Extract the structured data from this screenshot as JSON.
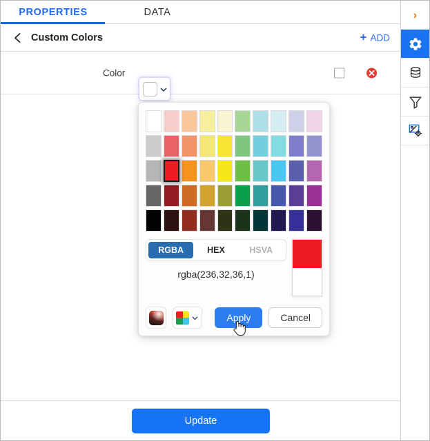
{
  "tabs": [
    {
      "label": "PROPERTIES",
      "active": true
    },
    {
      "label": "DATA",
      "active": false
    }
  ],
  "breadcrumb": {
    "back_icon": "chevron-left-icon",
    "title": "Custom Colors",
    "add_label": "ADD",
    "add_plus": "+"
  },
  "property_row": {
    "label": "Color",
    "swatch_value": "#ffffff",
    "caret_icon": "chevron-down-icon",
    "checkbox_checked": false,
    "delete_icon": "delete-circle-icon"
  },
  "picker": {
    "palette_rows": [
      [
        "#ffffff",
        "#f8cccb",
        "#fac79a",
        "#f6ef9c",
        "#f7f4cf",
        "#a6d796",
        "#aedfe8",
        "#d6ecf3",
        "#cfcfe8",
        "#f0d3e6"
      ],
      [
        "#cdcdcd",
        "#ec6264",
        "#f2936a",
        "#f5e872",
        "#f5e432",
        "#7fc77f",
        "#74cede",
        "#85dbe2",
        "#7e7dcb",
        "#9593cf"
      ],
      [
        "#b6b6b6",
        "#ed1c24",
        "#f5931e",
        "#fac96c",
        "#f6e718",
        "#6cbe45",
        "#68c8c9",
        "#4cc7f4",
        "#5a5fae",
        "#b267b0"
      ],
      [
        "#666666",
        "#931a20",
        "#ce6a22",
        "#d2a22f",
        "#9a9e33",
        "#08a04b",
        "#309e9d",
        "#4758ad",
        "#5b3d97",
        "#9a3296"
      ],
      [
        "#020202",
        "#2d110f",
        "#932d1f",
        "#653634",
        "#2d3314",
        "#1b3318",
        "#02373a",
        "#211a50",
        "#35309a",
        "#2b1031"
      ]
    ],
    "selected_row": 2,
    "selected_col": 1,
    "formats": [
      {
        "label": "RGBA",
        "state": "active"
      },
      {
        "label": "HEX",
        "state": "normal"
      },
      {
        "label": "HSVA",
        "state": "muted"
      }
    ],
    "value_text": "rgba(236,32,36,1)",
    "preview_new_color": "#ed1c24",
    "preview_old_color": "#ffffff",
    "gradient_icon": "gradient-picker-icon",
    "swatch_grid_icon": "palette-grid-icon",
    "swatch_grid_caret": "chevron-down-icon",
    "mini_grid_colors": [
      "#e8201f",
      "#f2e41c",
      "#1f9d4f",
      "#41c3f0"
    ],
    "apply_label": "Apply",
    "cancel_label": "Cancel",
    "cursor": "hand-pointer-cursor"
  },
  "footer": {
    "update_label": "Update"
  },
  "rail": [
    {
      "name": "expand-chevron-icon",
      "glyph": "›",
      "active": false
    },
    {
      "name": "gear-icon",
      "glyph": "",
      "active": true
    },
    {
      "name": "database-icon",
      "glyph": "",
      "active": false
    },
    {
      "name": "filter-funnel-icon",
      "glyph": "",
      "active": false
    },
    {
      "name": "image-settings-icon",
      "glyph": "",
      "active": false
    }
  ],
  "colors": {
    "accent_blue": "#1773f7",
    "tab_blue": "#2368f5",
    "selected_red": "#ed1c24",
    "add_blue": "#2b6cf6"
  }
}
